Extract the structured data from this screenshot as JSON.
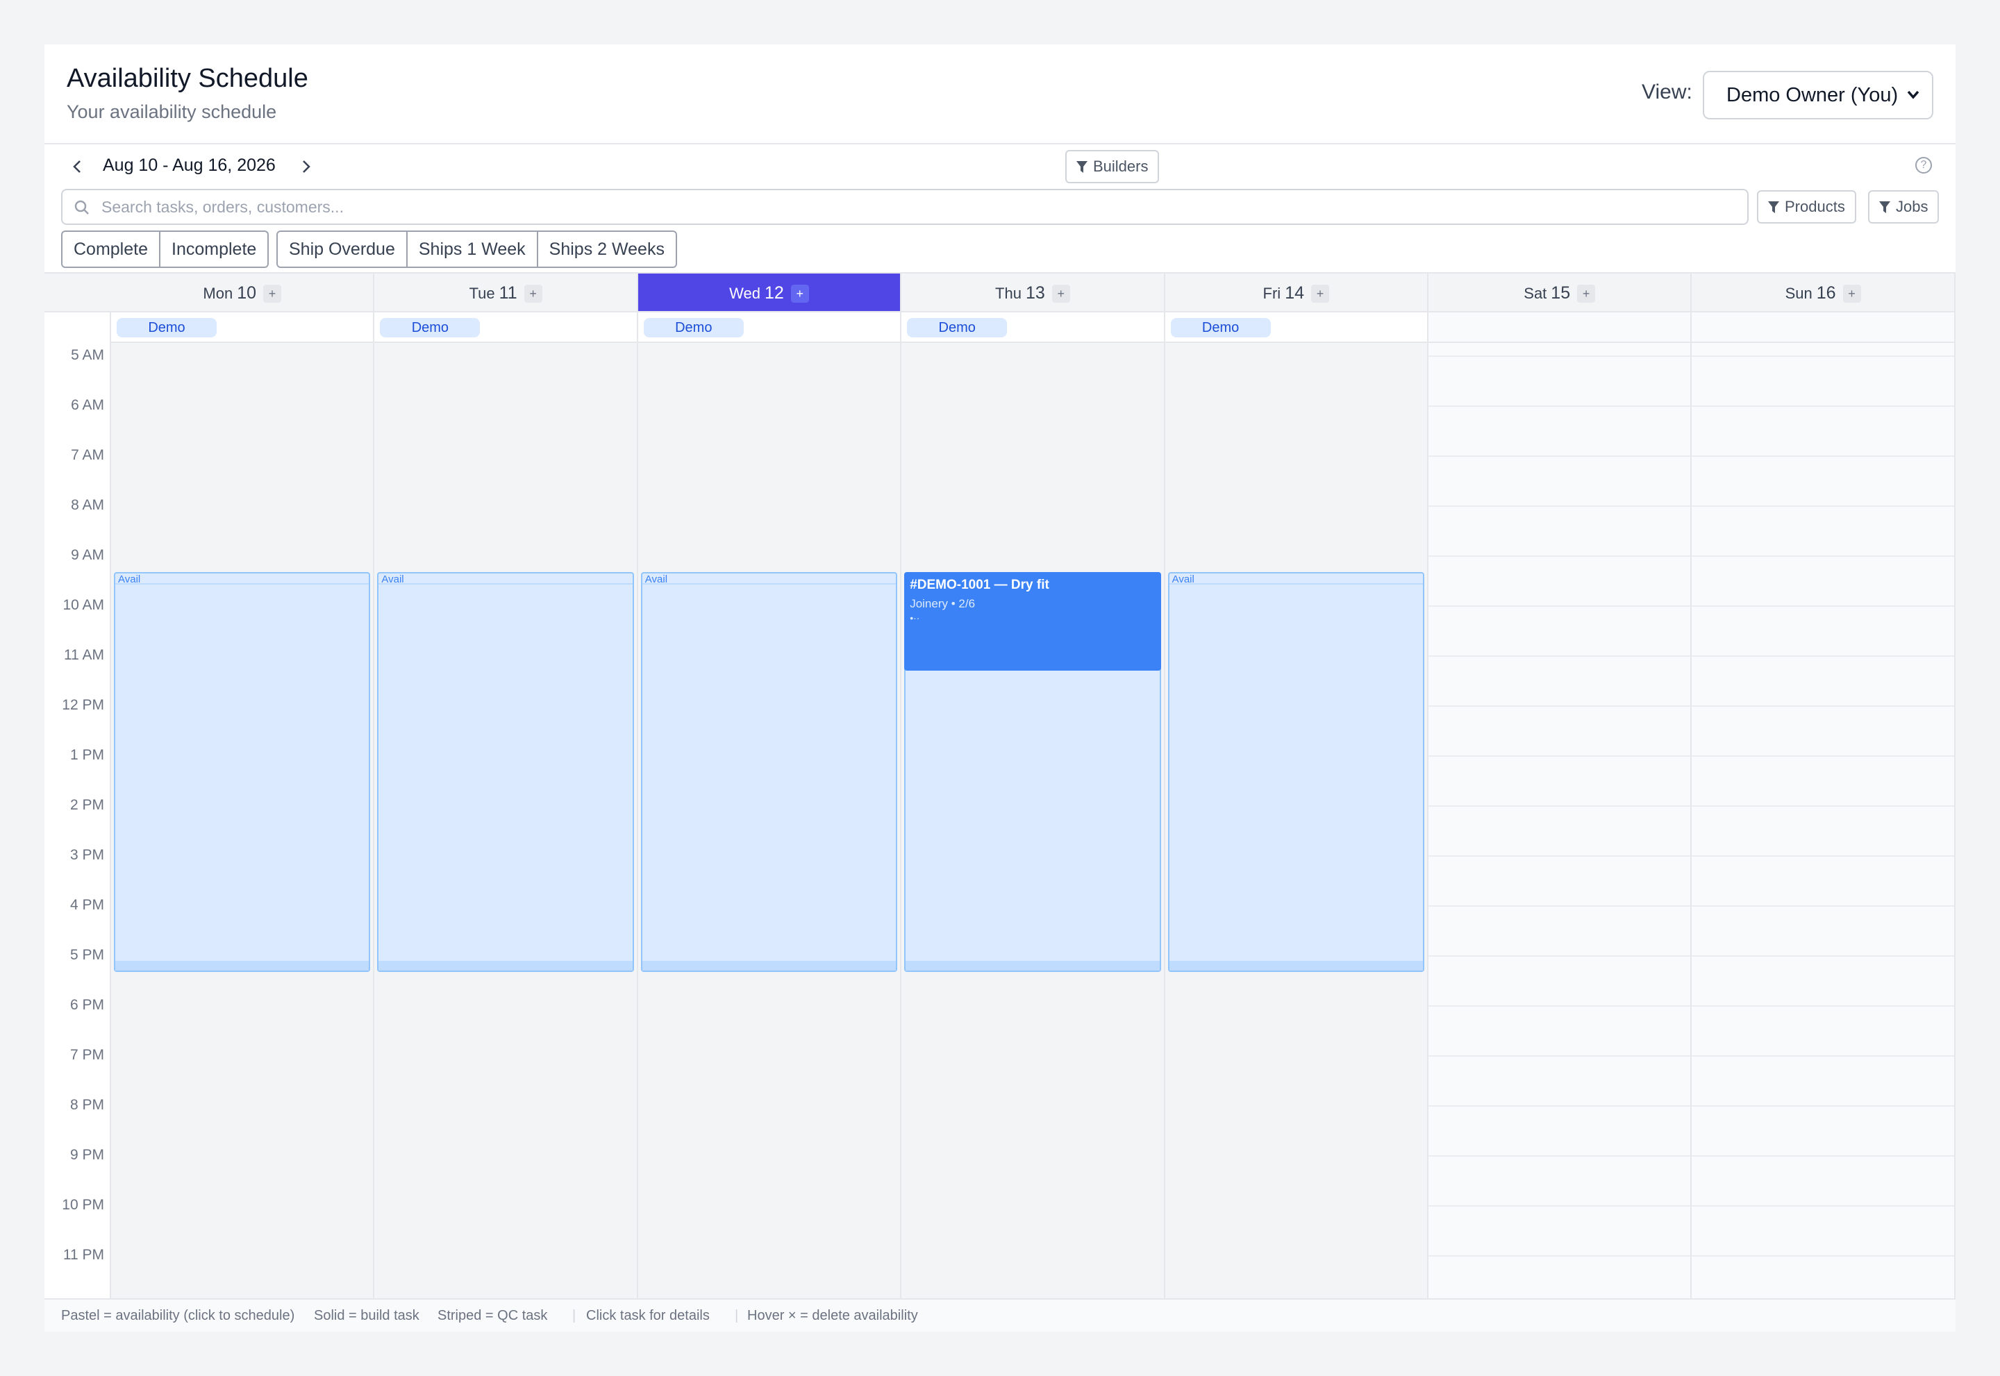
{
  "header": {
    "title": "Availability Schedule",
    "subtitle": "Your availability schedule",
    "view_label": "View:",
    "view_selected": "Demo Owner (You)"
  },
  "toolbar": {
    "date_range": "Aug 10 - Aug 16, 2026",
    "builders_label": "Builders",
    "products_label": "Products",
    "jobs_label": "Jobs",
    "search_placeholder": "Search tasks, orders, customers...",
    "status_filters": [
      "Complete",
      "Incomplete"
    ],
    "ship_filters": [
      "Ship Overdue",
      "Ships 1 Week",
      "Ships 2 Weeks"
    ],
    "help_icon": "help-circle-icon"
  },
  "calendar": {
    "hours": [
      "5 AM",
      "6 AM",
      "7 AM",
      "8 AM",
      "9 AM",
      "10 AM",
      "11 AM",
      "12 PM",
      "1 PM",
      "2 PM",
      "3 PM",
      "4 PM",
      "5 PM",
      "6 PM",
      "7 PM",
      "8 PM",
      "9 PM",
      "10 PM",
      "11 PM"
    ],
    "days": [
      {
        "dow": "Mon",
        "num": "10",
        "plus": "+",
        "owner": "Demo",
        "avail": "Avail"
      },
      {
        "dow": "Tue",
        "num": "11",
        "plus": "+",
        "owner": "Demo",
        "avail": "Avail"
      },
      {
        "dow": "Wed",
        "num": "12",
        "plus": "+",
        "owner": "Demo",
        "avail": "Avail",
        "today": true
      },
      {
        "dow": "Thu",
        "num": "13",
        "plus": "+",
        "owner": "Demo",
        "task": {
          "title": "#DEMO-1001 — Dry fit",
          "meta": "Joinery • 2/6",
          "extra": "•··"
        }
      },
      {
        "dow": "Fri",
        "num": "14",
        "plus": "+",
        "owner": "Demo",
        "avail": "Avail"
      },
      {
        "dow": "Sat",
        "num": "15",
        "plus": "+"
      },
      {
        "dow": "Sun",
        "num": "16",
        "plus": "+"
      }
    ],
    "today_color": "#4f46e5",
    "avail_color": "#dbeafe",
    "task_color": "#3b82f6"
  },
  "legend": {
    "items": [
      "Pastel = availability (click to schedule)",
      "Solid = build task",
      "Striped = QC task",
      "Click task for details",
      "Hover × = delete availability"
    ],
    "separator": "|"
  }
}
